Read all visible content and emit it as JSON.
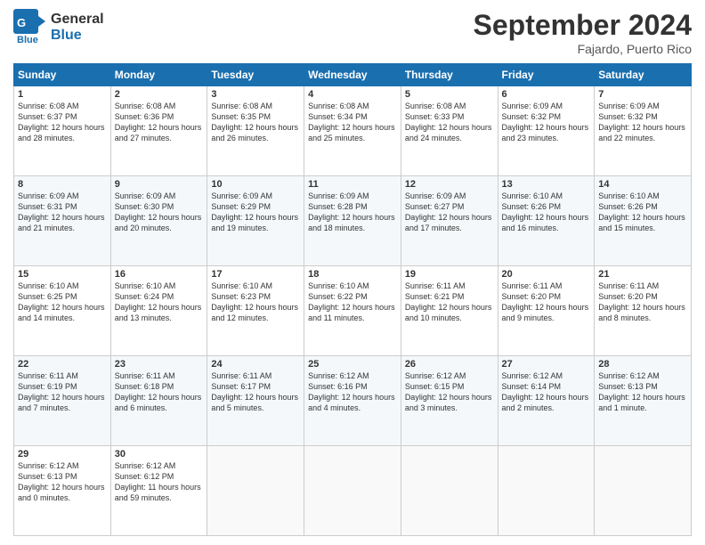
{
  "header": {
    "logo_line1": "General",
    "logo_line2": "Blue",
    "month": "September 2024",
    "location": "Fajardo, Puerto Rico"
  },
  "days_of_week": [
    "Sunday",
    "Monday",
    "Tuesday",
    "Wednesday",
    "Thursday",
    "Friday",
    "Saturday"
  ],
  "weeks": [
    [
      {
        "day": "1",
        "sunrise": "6:08 AM",
        "sunset": "6:37 PM",
        "daylight": "12 hours and 28 minutes."
      },
      {
        "day": "2",
        "sunrise": "6:08 AM",
        "sunset": "6:36 PM",
        "daylight": "12 hours and 27 minutes."
      },
      {
        "day": "3",
        "sunrise": "6:08 AM",
        "sunset": "6:35 PM",
        "daylight": "12 hours and 26 minutes."
      },
      {
        "day": "4",
        "sunrise": "6:08 AM",
        "sunset": "6:34 PM",
        "daylight": "12 hours and 25 minutes."
      },
      {
        "day": "5",
        "sunrise": "6:08 AM",
        "sunset": "6:33 PM",
        "daylight": "12 hours and 24 minutes."
      },
      {
        "day": "6",
        "sunrise": "6:09 AM",
        "sunset": "6:32 PM",
        "daylight": "12 hours and 23 minutes."
      },
      {
        "day": "7",
        "sunrise": "6:09 AM",
        "sunset": "6:32 PM",
        "daylight": "12 hours and 22 minutes."
      }
    ],
    [
      {
        "day": "8",
        "sunrise": "6:09 AM",
        "sunset": "6:31 PM",
        "daylight": "12 hours and 21 minutes."
      },
      {
        "day": "9",
        "sunrise": "6:09 AM",
        "sunset": "6:30 PM",
        "daylight": "12 hours and 20 minutes."
      },
      {
        "day": "10",
        "sunrise": "6:09 AM",
        "sunset": "6:29 PM",
        "daylight": "12 hours and 19 minutes."
      },
      {
        "day": "11",
        "sunrise": "6:09 AM",
        "sunset": "6:28 PM",
        "daylight": "12 hours and 18 minutes."
      },
      {
        "day": "12",
        "sunrise": "6:09 AM",
        "sunset": "6:27 PM",
        "daylight": "12 hours and 17 minutes."
      },
      {
        "day": "13",
        "sunrise": "6:10 AM",
        "sunset": "6:26 PM",
        "daylight": "12 hours and 16 minutes."
      },
      {
        "day": "14",
        "sunrise": "6:10 AM",
        "sunset": "6:26 PM",
        "daylight": "12 hours and 15 minutes."
      }
    ],
    [
      {
        "day": "15",
        "sunrise": "6:10 AM",
        "sunset": "6:25 PM",
        "daylight": "12 hours and 14 minutes."
      },
      {
        "day": "16",
        "sunrise": "6:10 AM",
        "sunset": "6:24 PM",
        "daylight": "12 hours and 13 minutes."
      },
      {
        "day": "17",
        "sunrise": "6:10 AM",
        "sunset": "6:23 PM",
        "daylight": "12 hours and 12 minutes."
      },
      {
        "day": "18",
        "sunrise": "6:10 AM",
        "sunset": "6:22 PM",
        "daylight": "12 hours and 11 minutes."
      },
      {
        "day": "19",
        "sunrise": "6:11 AM",
        "sunset": "6:21 PM",
        "daylight": "12 hours and 10 minutes."
      },
      {
        "day": "20",
        "sunrise": "6:11 AM",
        "sunset": "6:20 PM",
        "daylight": "12 hours and 9 minutes."
      },
      {
        "day": "21",
        "sunrise": "6:11 AM",
        "sunset": "6:20 PM",
        "daylight": "12 hours and 8 minutes."
      }
    ],
    [
      {
        "day": "22",
        "sunrise": "6:11 AM",
        "sunset": "6:19 PM",
        "daylight": "12 hours and 7 minutes."
      },
      {
        "day": "23",
        "sunrise": "6:11 AM",
        "sunset": "6:18 PM",
        "daylight": "12 hours and 6 minutes."
      },
      {
        "day": "24",
        "sunrise": "6:11 AM",
        "sunset": "6:17 PM",
        "daylight": "12 hours and 5 minutes."
      },
      {
        "day": "25",
        "sunrise": "6:12 AM",
        "sunset": "6:16 PM",
        "daylight": "12 hours and 4 minutes."
      },
      {
        "day": "26",
        "sunrise": "6:12 AM",
        "sunset": "6:15 PM",
        "daylight": "12 hours and 3 minutes."
      },
      {
        "day": "27",
        "sunrise": "6:12 AM",
        "sunset": "6:14 PM",
        "daylight": "12 hours and 2 minutes."
      },
      {
        "day": "28",
        "sunrise": "6:12 AM",
        "sunset": "6:13 PM",
        "daylight": "12 hours and 1 minute."
      }
    ],
    [
      {
        "day": "29",
        "sunrise": "6:12 AM",
        "sunset": "6:13 PM",
        "daylight": "12 hours and 0 minutes."
      },
      {
        "day": "30",
        "sunrise": "6:12 AM",
        "sunset": "6:12 PM",
        "daylight": "11 hours and 59 minutes."
      },
      null,
      null,
      null,
      null,
      null
    ]
  ]
}
